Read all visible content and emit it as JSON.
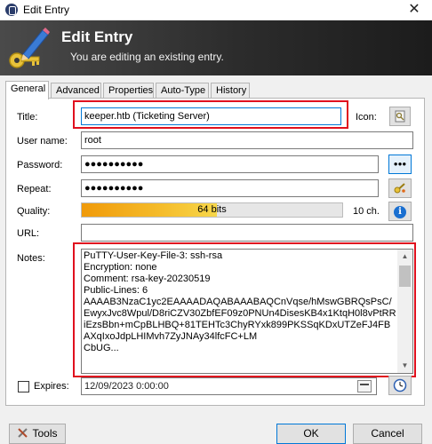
{
  "window": {
    "title": "Edit Entry",
    "close_glyph": "✕"
  },
  "banner": {
    "title": "Edit Entry",
    "subtitle": "You are editing an existing entry."
  },
  "tabs": [
    {
      "label": "General",
      "active": true
    },
    {
      "label": "Advanced"
    },
    {
      "label": "Properties"
    },
    {
      "label": "Auto-Type"
    },
    {
      "label": "History"
    }
  ],
  "form": {
    "title_label": "Title:",
    "title_value": "keeper.htb (Ticketing Server)",
    "icon_label": "Icon:",
    "username_label": "User name:",
    "username_value": "root",
    "password_label": "Password:",
    "password_value": "●●●●●●●●●●",
    "show_password_glyph": "●●●",
    "repeat_label": "Repeat:",
    "repeat_value": "●●●●●●●●●●",
    "quality_label": "Quality:",
    "quality_text": "64 bits",
    "quality_fraction": 0.52,
    "quality_chars": "10 ch.",
    "info_glyph": "i",
    "url_label": "URL:",
    "url_value": "",
    "notes_label": "Notes:",
    "notes_text": "PuTTY-User-Key-File-3: ssh-rsa\nEncryption: none\nComment: rsa-key-20230519\nPublic-Lines: 6\nAAAAB3NzaC1yc2EAAAADAQABAAABAQCnVqse/hMswGBRQsPsC/EwyxJvc8Wpul/D8riCZV30ZbfEF09z0PNUn4DisesKB4x1KtqH0l8vPtRRiEzsBbn+mCpBLHBQ+81TEHTc3ChyRYxk899PKSSqKDxUTZeFJ4FBAXqIxoJdpLHIMvh7ZyJNAy34lfcFC+LM\nCbUG...",
    "expires_label": "Expires:",
    "expires_value": "12/09/2023   0:00:00"
  },
  "footer": {
    "tools_label": "Tools",
    "ok_label": "OK",
    "cancel_label": "Cancel"
  },
  "colors": {
    "accent": "#0078d7",
    "highlight": "#e0101e",
    "quality": "#f5bd2c"
  }
}
